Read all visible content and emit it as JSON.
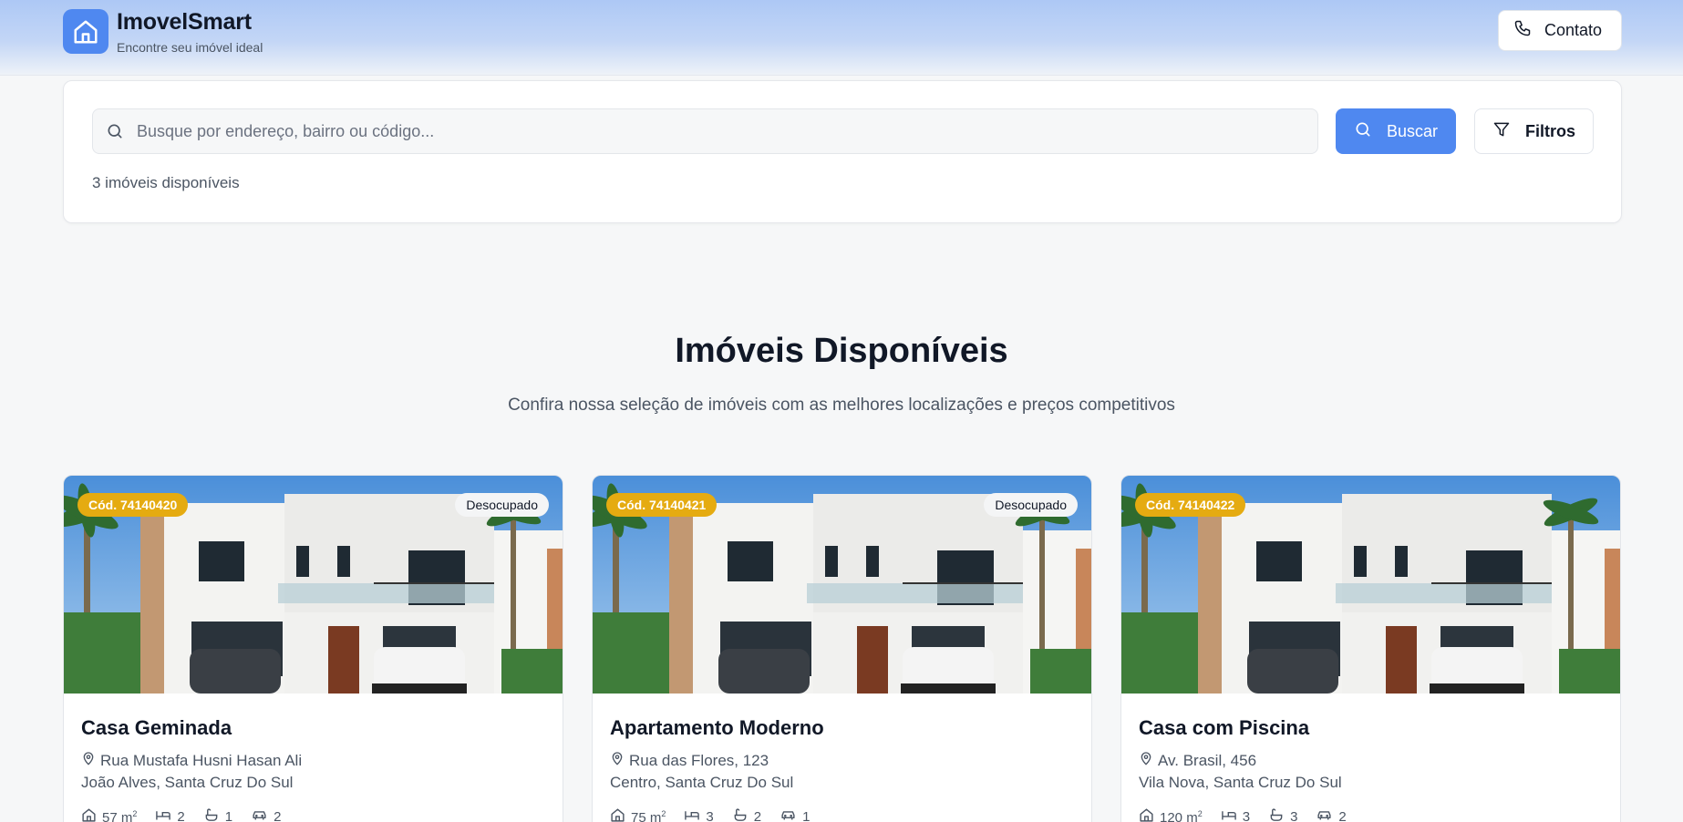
{
  "header": {
    "brand_name": "ImovelSmart",
    "tagline": "Encontre seu imóvel ideal",
    "contact_label": "Contato"
  },
  "search": {
    "placeholder": "Busque por endereço, bairro ou código...",
    "value": "",
    "buscar_label": "Buscar",
    "filtros_label": "Filtros",
    "count_text": "3 imóveis disponíveis"
  },
  "section": {
    "title": "Imóveis Disponíveis",
    "subtitle": "Confira nossa seleção de imóveis com as melhores localizações e preços competitivos"
  },
  "colors": {
    "accent": "#4f88f0",
    "code_badge": "#e5ab11"
  },
  "properties": [
    {
      "code": "Cód. 74140420",
      "status": "Desocupado",
      "title": "Casa Geminada",
      "street": "Rua Mustafa Husni Hasan Ali",
      "district": "João Alves, Santa Cruz Do Sul",
      "area": "57 m",
      "bedrooms": "2",
      "bathrooms": "1",
      "parking": "2"
    },
    {
      "code": "Cód. 74140421",
      "status": "Desocupado",
      "title": "Apartamento Moderno",
      "street": "Rua das Flores, 123",
      "district": "Centro, Santa Cruz Do Sul",
      "area": "75 m",
      "bedrooms": "3",
      "bathrooms": "2",
      "parking": "1"
    },
    {
      "code": "Cód. 74140422",
      "status": "",
      "title": "Casa com Piscina",
      "street": "Av. Brasil, 456",
      "district": "Vila Nova, Santa Cruz Do Sul",
      "area": "120 m",
      "bedrooms": "3",
      "bathrooms": "3",
      "parking": "2"
    }
  ],
  "icons": {
    "logo": "house-icon",
    "contact": "phone-icon",
    "search": "search-icon",
    "filter": "filter-icon",
    "address": "map-pin-icon",
    "area": "home-area-icon",
    "bedrooms": "bed-icon",
    "bathrooms": "bath-icon",
    "parking": "car-icon"
  }
}
